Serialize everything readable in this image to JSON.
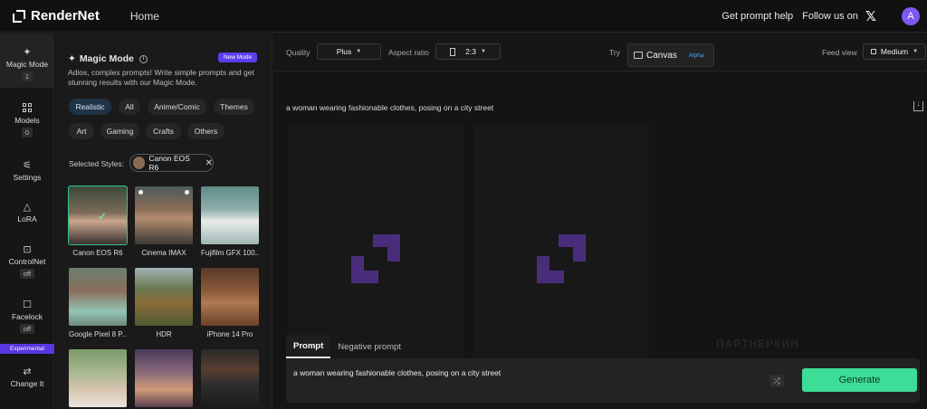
{
  "header": {
    "brand": "RenderNet",
    "nav_home": "Home",
    "get_prompt_help": "Get prompt help",
    "follow_us": "Follow us on",
    "avatar_initial": "A"
  },
  "rail": {
    "magic_mode": {
      "label": "Magic Mode",
      "badge": "1"
    },
    "models": {
      "label": "Models",
      "badge": "0"
    },
    "settings": {
      "label": "Settings"
    },
    "lora": {
      "label": "LoRA"
    },
    "controlnet": {
      "label": "ControlNet",
      "badge": "off"
    },
    "facelock": {
      "label": "Facelock",
      "badge": "off"
    },
    "experimental": "Experimental",
    "change_it": {
      "label": "Change It"
    }
  },
  "panel": {
    "title": "Magic Mode",
    "new_badge": "New Mode",
    "description": "Adios, complex prompts! Write simple prompts and get stunning results with our Magic Mode.",
    "chips": [
      "Realistic",
      "All",
      "Anime/Comic",
      "Themes",
      "Art",
      "Gaming",
      "Crafts",
      "Others"
    ],
    "active_chip": "Realistic",
    "selected_label": "Selected Styles:",
    "selected_style": "Canon EOS R6",
    "cards": [
      {
        "label": "Canon EOS R6",
        "selected": true
      },
      {
        "label": "Cinema IMAX"
      },
      {
        "label": "Fujifilm GFX 100..."
      },
      {
        "label": "Google Pixel 8 P..."
      },
      {
        "label": "HDR"
      },
      {
        "label": "iPhone 14 Pro"
      },
      {
        "label": ""
      },
      {
        "label": ""
      },
      {
        "label": ""
      }
    ]
  },
  "toolbar": {
    "quality_label": "Quality",
    "quality_value": "Plus",
    "aspect_label": "Aspect ratio",
    "aspect_value": "2:3",
    "try_label": "Try",
    "canvas_label": "Canvas",
    "canvas_badge": "Alpha",
    "feed_label": "Feed view",
    "feed_value": "Medium"
  },
  "main": {
    "prompt_caption": "a woman wearing fashionable clothes, posing on a city street",
    "tab_prompt": "Prompt",
    "tab_negative": "Negative prompt",
    "prompt_value": "a woman wearing fashionable clothes, posing on a city street",
    "generate_label": "Generate",
    "watermark": "ПАРТНЕРКИН"
  },
  "colors": {
    "accent_green": "#3ddc97",
    "accent_purple": "#5b3ef0",
    "placeholder_logo": "#4a2d7a"
  }
}
